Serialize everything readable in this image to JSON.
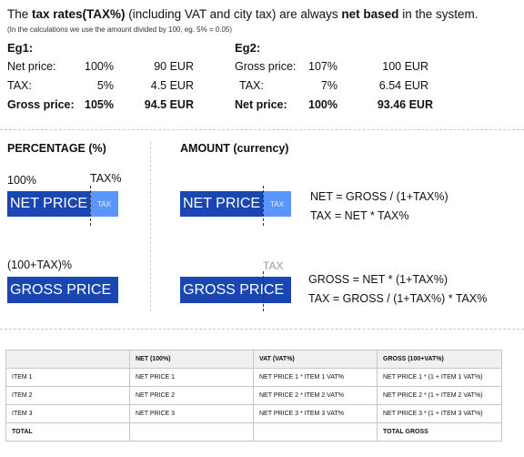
{
  "intro": {
    "t1": "The ",
    "b1": "tax rates(TAX%)",
    "t2": " (including VAT and city tax) are always ",
    "b2": "net based",
    "t3": " in the system.",
    "note": "(In the calculations we use the amount divided by 100, eg. 5% = 0.05)"
  },
  "eg1": {
    "title": "Eg1:",
    "rows": [
      {
        "label": "Net price:",
        "pct": "100%",
        "amount": "90 EUR"
      },
      {
        "label": "TAX:",
        "pct": "5%",
        "amount": "4.5 EUR"
      },
      {
        "label": "Gross price:",
        "pct": "105%",
        "amount": "94.5 EUR"
      }
    ]
  },
  "eg2": {
    "title": "Eg2:",
    "rows": [
      {
        "label": "Gross price:",
        "pct": "107%",
        "amount": "100 EUR"
      },
      {
        "label": "TAX:",
        "pct": "7%",
        "amount": "6.54 EUR"
      },
      {
        "label": "Net price:",
        "pct": "100%",
        "amount": "93.46 EUR"
      }
    ]
  },
  "percentage": {
    "heading": "PERCENTAGE (%)",
    "label_100": "100%",
    "label_tax": "TAX%",
    "net_box": "NET PRICE",
    "tax_box": "TAX",
    "label_100_tax": "(100+TAX)%",
    "gross_box": "GROSS PRICE"
  },
  "amount": {
    "heading": "AMOUNT (currency)",
    "net_box": "NET PRICE",
    "tax_box": "TAX",
    "f1": "NET = GROSS / (1+TAX%)",
    "f2": "TAX = NET * TAX%",
    "tax_faded": "TAX",
    "gross_box": "GROSS PRICE",
    "f3": "GROSS = NET * (1+TAX%)",
    "f4": "TAX = GROSS / (1+TAX%) * TAX%"
  },
  "table": {
    "headers": [
      "",
      "NET (100%)",
      "VAT (VAT%)",
      "GROSS (100+VAT%)"
    ],
    "rows": [
      [
        "ITEM 1",
        "NET PRICE 1",
        "NET PRICE 1 * ITEM 1 VAT%",
        "NET PRICE 1 * (1 + ITEM 1 VAT%)"
      ],
      [
        "ITEM 2",
        "NET PRICE 2",
        "NET PRICE 2 * ITEM 2 VAT%",
        "NET PRICE 2 * (1 + ITEM 2 VAT%)"
      ],
      [
        "ITEM 3",
        "NET PRICE 3",
        "NET PRICE 3 * ITEM 3 VAT%",
        "NET PRICE 3 * (1 + ITEM 3 VAT%)"
      ],
      [
        "TOTAL",
        "",
        "",
        "TOTAL GROSS"
      ]
    ]
  },
  "colors": {
    "dark_box": "#1946b3",
    "light_box": "#5b95ff"
  }
}
